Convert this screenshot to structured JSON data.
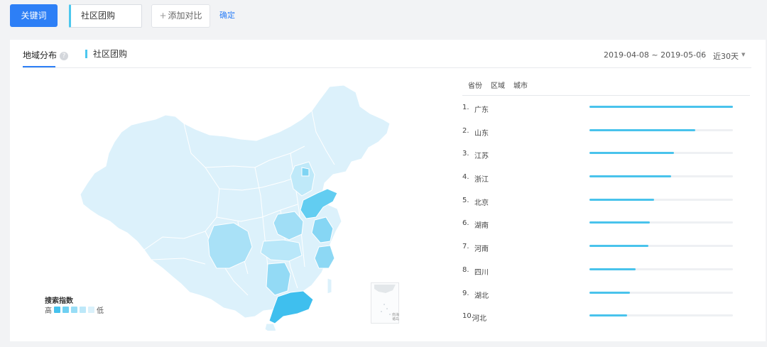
{
  "toolbar": {
    "keyword_button": "关键词",
    "keyword_value": "社区团购",
    "add_compare": "添加对比",
    "confirm": "确定"
  },
  "panel": {
    "tab_label": "地域分布",
    "help_icon": "question-circle-icon",
    "keyword_tag": "社区团购",
    "date_range": "2019-04-08 ~ 2019-05-06",
    "period": "近30天",
    "caret_icon": "caret-down-icon"
  },
  "legend": {
    "title": "搜索指数",
    "high": "高",
    "low": "低",
    "colors": [
      "#45c2ee",
      "#6fd0f2",
      "#98ddf6",
      "#bde8f9",
      "#daf1fb"
    ]
  },
  "inset": {
    "label": "南海诸岛"
  },
  "ranking": {
    "tabs": [
      "省份",
      "区域",
      "城市"
    ],
    "items": [
      {
        "rank": "1.",
        "name": "广东",
        "value": 1.0
      },
      {
        "rank": "2.",
        "name": "山东",
        "value": 0.74
      },
      {
        "rank": "3.",
        "name": "江苏",
        "value": 0.59
      },
      {
        "rank": "4.",
        "name": "浙江",
        "value": 0.57
      },
      {
        "rank": "5.",
        "name": "北京",
        "value": 0.45
      },
      {
        "rank": "6.",
        "name": "湖南",
        "value": 0.42
      },
      {
        "rank": "7.",
        "name": "河南",
        "value": 0.41
      },
      {
        "rank": "8.",
        "name": "四川",
        "value": 0.32
      },
      {
        "rank": "9.",
        "name": "湖北",
        "value": 0.28
      },
      {
        "rank": "10.",
        "name": "河北",
        "value": 0.26
      }
    ]
  },
  "colors": {
    "accent": "#2d7ff6",
    "bar": "#49c3ec",
    "map_base": "#dff2fb"
  }
}
